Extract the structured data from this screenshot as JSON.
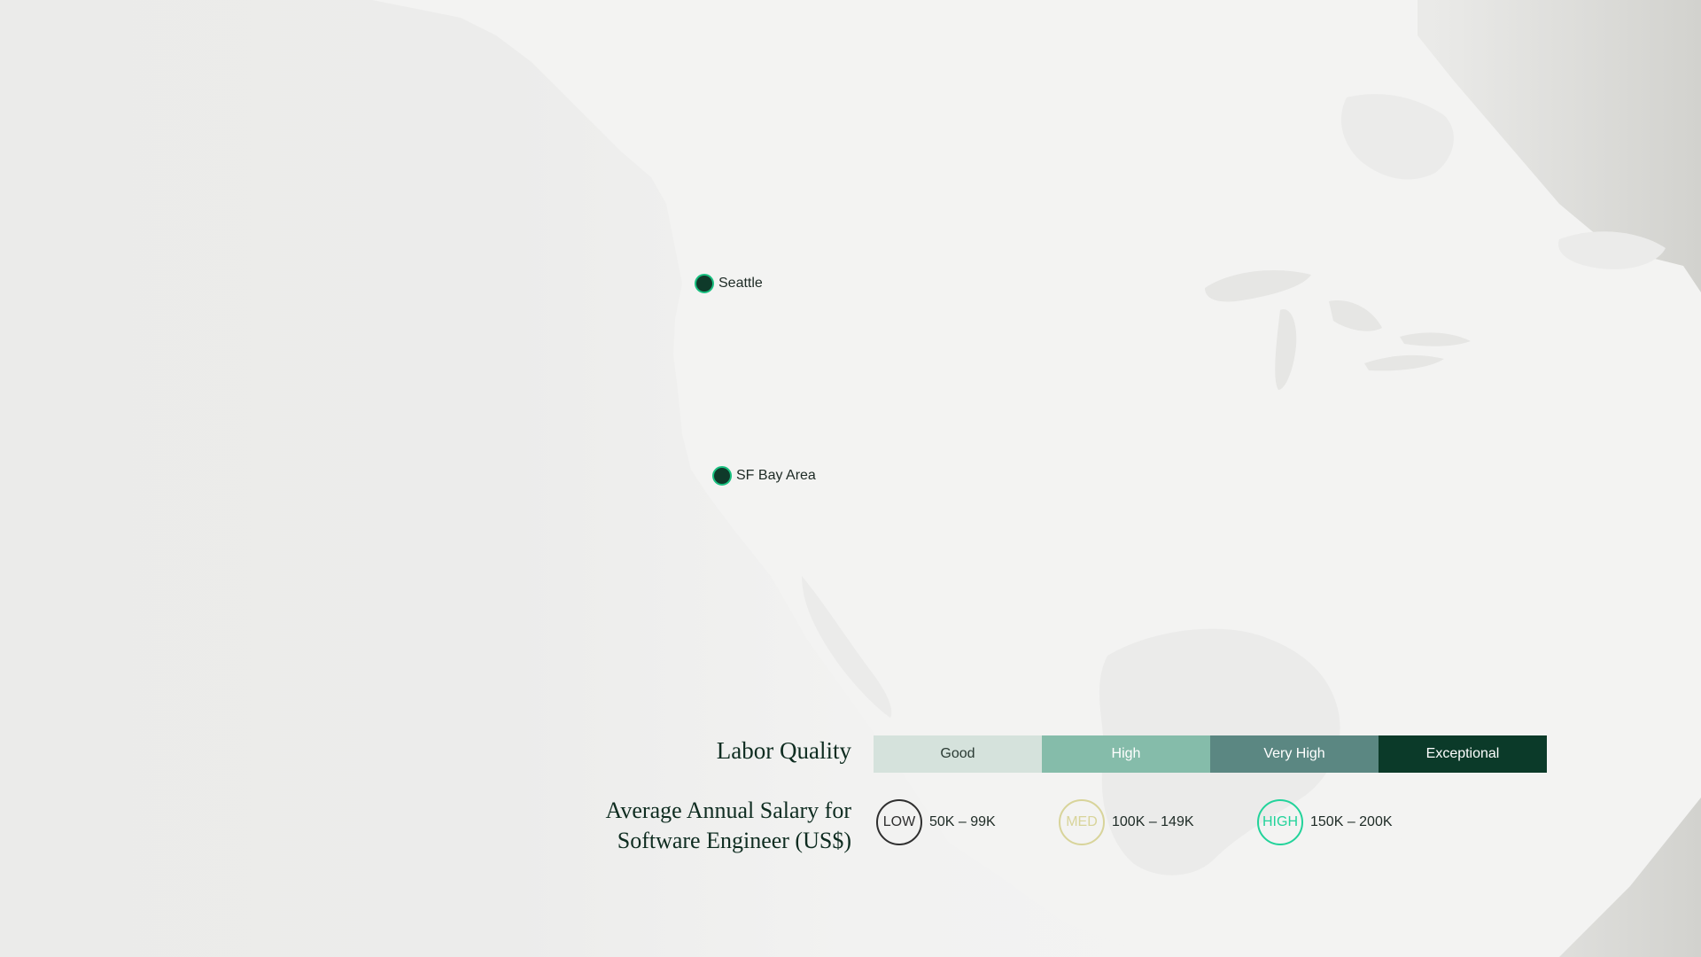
{
  "map": {
    "colors": {
      "land": "#f3f3f2",
      "water": "#ebebea",
      "marker_fill": "#0f3a2a",
      "marker_ring": "#19c080"
    },
    "markers": [
      {
        "label": "Seattle"
      },
      {
        "label": "SF Bay Area"
      }
    ]
  },
  "legend": {
    "labor_quality": {
      "title": "Labor Quality",
      "levels": [
        {
          "label": "Good",
          "color": "#d5e2dc",
          "text_color": "#2a3a33"
        },
        {
          "label": "High",
          "color": "#85bcaa",
          "text_color": "#ffffff"
        },
        {
          "label": "Very High",
          "color": "#5b8782",
          "text_color": "#ffffff"
        },
        {
          "label": "Exceptional",
          "color": "#0b3a29",
          "text_color": "#ffffff"
        }
      ]
    },
    "salary": {
      "title_line1": "Average Annual Salary for",
      "title_line2": "Software Engineer (US$)",
      "levels": [
        {
          "badge": "LOW",
          "range": "50K – 99K",
          "color": "#2f2f2f"
        },
        {
          "badge": "MED",
          "range": "100K – 149K",
          "color": "#d8d49a"
        },
        {
          "badge": "HIGH",
          "range": "150K – 200K",
          "color": "#22d39a"
        }
      ]
    }
  }
}
